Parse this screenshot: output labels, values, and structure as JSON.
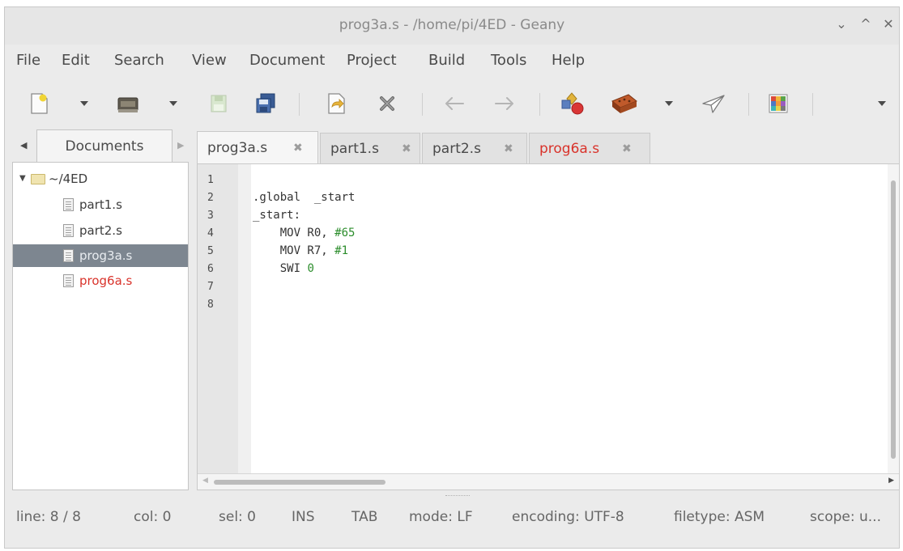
{
  "window": {
    "title": "prog3a.s - /home/pi/4ED - Geany",
    "controls": [
      "⌄",
      "^",
      "✕"
    ]
  },
  "menu": [
    "File",
    "Edit",
    "Search",
    "View",
    "Document",
    "Project",
    "Build",
    "Tools",
    "Help"
  ],
  "toolbar": {
    "icons": [
      "new-file-icon",
      "open-file-icon",
      "save-icon",
      "save-all-icon",
      "revert-icon",
      "close-file-icon",
      "navigate-back-icon",
      "navigate-forward-icon",
      "compile-icon",
      "build-icon",
      "run-icon",
      "color-chooser-icon"
    ]
  },
  "sidebar": {
    "tab_label": "Documents",
    "folder": "~/4ED",
    "files": [
      {
        "name": "part1.s",
        "selected": false,
        "modified": false
      },
      {
        "name": "part2.s",
        "selected": false,
        "modified": false
      },
      {
        "name": "prog3a.s",
        "selected": true,
        "modified": false
      },
      {
        "name": "prog6a.s",
        "selected": false,
        "modified": true
      }
    ]
  },
  "tabs": [
    {
      "label": "prog3a.s",
      "close": "✖",
      "active": true,
      "modified": false
    },
    {
      "label": "part1.s",
      "close": "✖",
      "active": false,
      "modified": false
    },
    {
      "label": "part2.s",
      "close": "✖",
      "active": false,
      "modified": false
    },
    {
      "label": "prog6a.s",
      "close": "✖",
      "active": false,
      "modified": true
    }
  ],
  "editor": {
    "line_numbers": [
      "1",
      "2",
      "3",
      "4",
      "5",
      "6",
      "7",
      "8"
    ],
    "lines": [
      "",
      ".global  _start",
      "_start:",
      "    MOV R0, #65",
      "    MOV R7, #1",
      "    SWI 0",
      "",
      ""
    ]
  },
  "status": {
    "line": "line: 8 / 8",
    "col": "col: 0",
    "sel": "sel: 0",
    "ins": "INS",
    "tab": "TAB",
    "mode": "mode: LF",
    "encoding": "encoding: UTF-8",
    "filetype": "filetype: ASM",
    "scope": "scope: u..."
  },
  "colors": {
    "modified_text": "#d9332b",
    "number_literal": "#2c8d2c",
    "selection": "#7d8690"
  }
}
